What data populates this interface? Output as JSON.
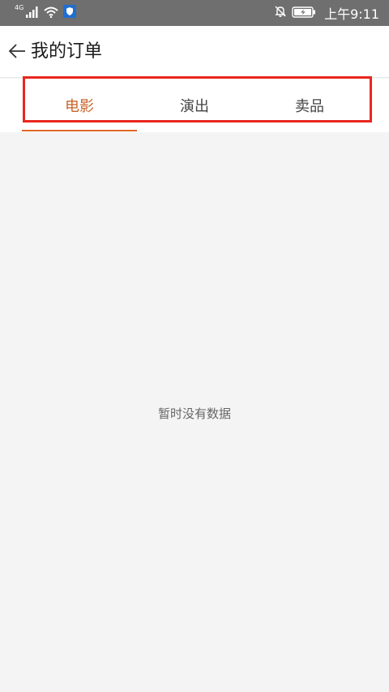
{
  "status_bar": {
    "network": "4G",
    "time": "上午9:11",
    "icons": [
      "signal-icon",
      "wifi-icon",
      "shield-app-icon",
      "bell-muted-icon",
      "battery-charging-icon"
    ]
  },
  "header": {
    "back_icon": "arrow-left-icon",
    "title": "我的订单"
  },
  "tabs": [
    {
      "label": "电影",
      "active": true
    },
    {
      "label": "演出",
      "active": false
    },
    {
      "label": "卖品",
      "active": false
    }
  ],
  "content": {
    "empty_message": "暂时没有数据"
  },
  "colors": {
    "accent": "#e0662a",
    "active_tab_text": "#c9632a",
    "highlight_box": "#e8271f",
    "status_bar_bg": "#6f6f6f",
    "content_bg": "#f4f4f4"
  }
}
